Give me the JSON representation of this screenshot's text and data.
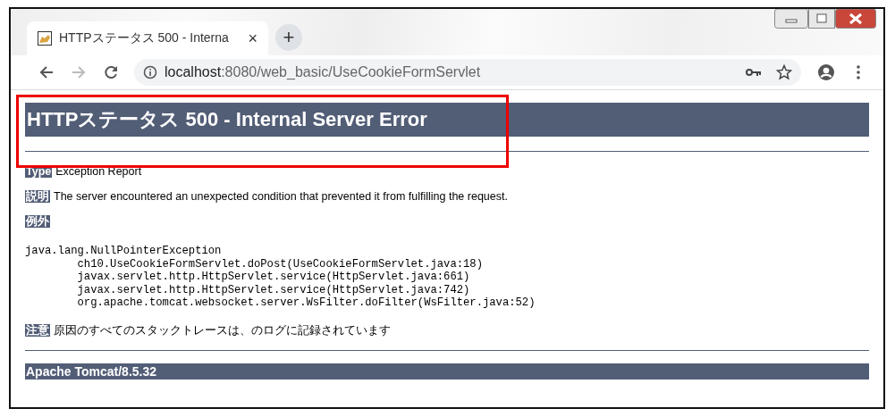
{
  "window": {
    "tabs": [
      {
        "title": "HTTPステータス 500 - Interna",
        "close": "×",
        "selected": true
      }
    ],
    "new_tab": "+",
    "address": {
      "host": "localhost",
      "path": ":8080/web_basic/UseCookieFormServlet"
    }
  },
  "page": {
    "heading": "HTTPステータス 500 - Internal Server Error",
    "fields": [
      {
        "label": "Type",
        "text": "Exception Report"
      },
      {
        "label": "説明",
        "text": "The server encountered an unexpected condition that prevented it from fulfilling the request."
      }
    ],
    "exception_label": "例外",
    "exception": "java.lang.NullPointerException",
    "frames": [
      "ch10.UseCookieFormServlet.doPost(UseCookieFormServlet.java:18)",
      "javax.servlet.http.HttpServlet.service(HttpServlet.java:661)",
      "javax.servlet.http.HttpServlet.service(HttpServlet.java:742)",
      "org.apache.tomcat.websocket.server.WsFilter.doFilter(WsFilter.java:52)"
    ],
    "note": {
      "label": "注意",
      "text": "原因のすべてのスタックトレースは、のログに記録されています"
    },
    "footer": "Apache Tomcat/8.5.32"
  }
}
